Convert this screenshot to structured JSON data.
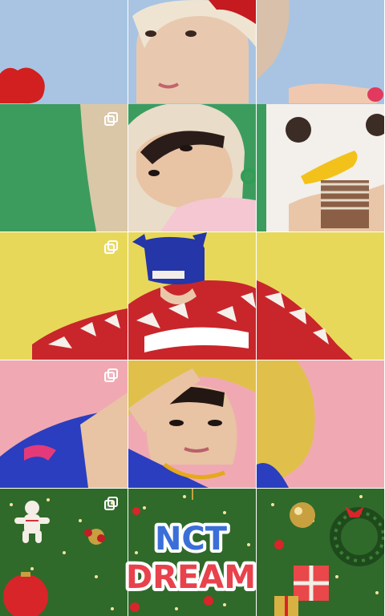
{
  "feed": {
    "colors": {
      "sky_blue": "#a8c4e2",
      "green": "#3c9c5e",
      "yellow": "#e8d85a",
      "pink": "#f0a9b2",
      "grass": "#2f6a2a"
    },
    "logo": {
      "line1": "NCT",
      "line2": "DREAM"
    },
    "multi_post_icon": "multiple-photos-icon"
  }
}
